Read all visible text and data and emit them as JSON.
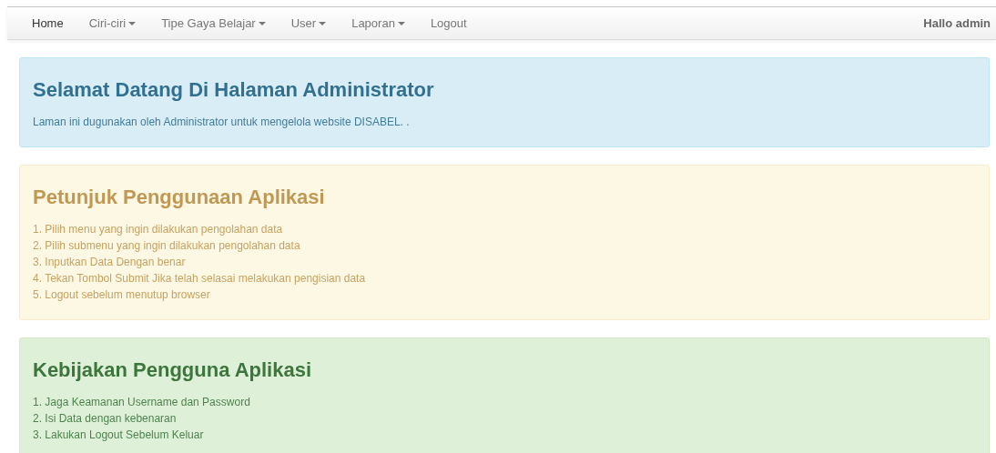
{
  "navbar": {
    "items": [
      {
        "label": "Home",
        "kind": "link",
        "selected": true
      },
      {
        "label": "Ciri-ciri",
        "kind": "dropdown",
        "selected": false
      },
      {
        "label": "Tipe Gaya Belajar",
        "kind": "dropdown",
        "selected": false
      },
      {
        "label": "User",
        "kind": "dropdown",
        "selected": false
      },
      {
        "label": "Laporan",
        "kind": "dropdown",
        "selected": false
      },
      {
        "label": "Logout",
        "kind": "link",
        "selected": false
      }
    ],
    "greeting": "Hallo admin"
  },
  "panels": [
    {
      "kind": "info",
      "title": "Selamat Datang Di Halaman Administrator",
      "lines": [
        "Laman ini dugunakan oleh Administrator untuk mengelola website DISABEL. ."
      ]
    },
    {
      "kind": "warning",
      "title": "Petunjuk Penggunaan Aplikasi",
      "lines": [
        "1. Pilih menu yang ingin dilakukan pengolahan data",
        "2. Pilih submenu yang ingin dilakukan pengolahan data",
        "3. Inputkan Data Dengan benar",
        "4. Tekan Tombol Submit Jika telah selasai melakukan pengisian data",
        "5. Logout sebelum menutup browser"
      ]
    },
    {
      "kind": "success",
      "title": "Kebijakan Pengguna Aplikasi",
      "lines": [
        "1. Jaga Keamanan Username dan Password",
        "2. Isi Data dengan kebenaran",
        "3. Lakukan Logout Sebelum Keluar"
      ]
    }
  ]
}
